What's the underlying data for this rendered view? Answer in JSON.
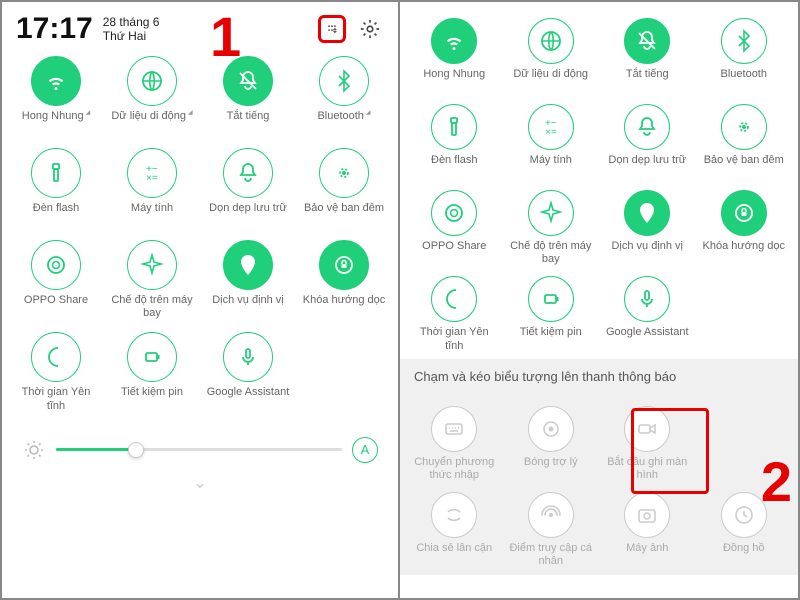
{
  "left": {
    "time": "17:17",
    "date_line1": "28 tháng 6",
    "date_line2": "Thứ Hai",
    "auto_label": "A",
    "tiles": [
      {
        "label": "Hong Nhung",
        "icon": "wifi",
        "on": true,
        "arrow": true
      },
      {
        "label": "Dữ liệu di động",
        "icon": "globe",
        "on": false,
        "arrow": true
      },
      {
        "label": "Tắt tiếng",
        "icon": "bell-off",
        "on": true,
        "arrow": false
      },
      {
        "label": "Bluetooth",
        "icon": "bluetooth",
        "on": false,
        "arrow": true
      },
      {
        "label": "Đèn flash",
        "icon": "flashlight",
        "on": false
      },
      {
        "label": "Máy tính",
        "icon": "calc",
        "on": false
      },
      {
        "label": "Dọn dẹp lưu trữ",
        "icon": "bell",
        "on": false
      },
      {
        "label": "Bảo vệ ban đêm",
        "icon": "night",
        "on": false
      },
      {
        "label": "OPPO Share",
        "icon": "share",
        "on": false
      },
      {
        "label": "Chế độ trên máy bay",
        "icon": "airplane",
        "on": false
      },
      {
        "label": "Dịch vụ định vị",
        "icon": "location",
        "on": true
      },
      {
        "label": "Khóa hướng dọc",
        "icon": "lock-rot",
        "on": true
      },
      {
        "label": "Thời gian Yên tĩnh",
        "icon": "moon",
        "on": false
      },
      {
        "label": "Tiết kiệm pin",
        "icon": "battery",
        "on": false
      },
      {
        "label": "Google Assistant",
        "icon": "mic",
        "on": false
      }
    ]
  },
  "right": {
    "tiles": [
      {
        "label": "Hong Nhung",
        "icon": "wifi",
        "on": true
      },
      {
        "label": "Dữ liệu di động",
        "icon": "globe",
        "on": false
      },
      {
        "label": "Tắt tiếng",
        "icon": "bell-off",
        "on": true
      },
      {
        "label": "Bluetooth",
        "icon": "bluetooth",
        "on": false
      },
      {
        "label": "Đèn flash",
        "icon": "flashlight",
        "on": false
      },
      {
        "label": "Máy tính",
        "icon": "calc",
        "on": false
      },
      {
        "label": "Dọn dẹp lưu trữ",
        "icon": "bell",
        "on": false
      },
      {
        "label": "Bảo vệ ban đêm",
        "icon": "night",
        "on": false
      },
      {
        "label": "OPPO Share",
        "icon": "share",
        "on": false
      },
      {
        "label": "Chế độ trên máy bay",
        "icon": "airplane",
        "on": false
      },
      {
        "label": "Dịch vụ định vị",
        "icon": "location",
        "on": true
      },
      {
        "label": "Khóa hướng dọc",
        "icon": "lock-rot",
        "on": true
      },
      {
        "label": "Thời gian Yên tĩnh",
        "icon": "moon",
        "on": false
      },
      {
        "label": "Tiết kiệm pin",
        "icon": "battery",
        "on": false
      },
      {
        "label": "Google Assistant",
        "icon": "mic",
        "on": false
      }
    ],
    "instruction": "Chạm và kéo biểu tượng lên thanh thông báo",
    "available": [
      {
        "label": "Chuyển phương thức nhập",
        "icon": "keyboard"
      },
      {
        "label": "Bóng trợ lý",
        "icon": "dot"
      },
      {
        "label": "Bắt đầu ghi màn hình",
        "icon": "record"
      },
      {
        "label": "",
        "icon": "blank"
      },
      {
        "label": "Chia sẻ lân cận",
        "icon": "near"
      },
      {
        "label": "Điểm truy cập cá nhân",
        "icon": "hotspot"
      },
      {
        "label": "Máy ảnh",
        "icon": "camera"
      },
      {
        "label": "Đồng hồ",
        "icon": "clock"
      }
    ]
  },
  "annotations": {
    "one": "1",
    "two": "2"
  }
}
